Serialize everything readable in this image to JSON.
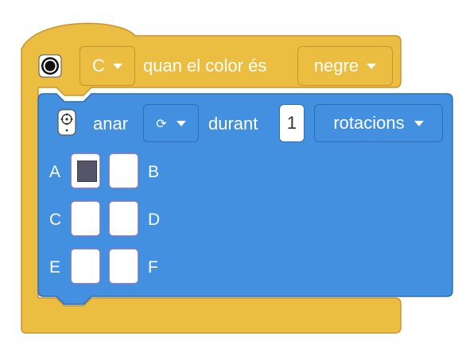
{
  "hat_block": {
    "port_value": "C",
    "condition_text": "quan el color és",
    "color_value": "negre",
    "color_hex": "#ebbd40"
  },
  "motor_block": {
    "action_text": "anar",
    "direction_icon": "rotate-icon",
    "direction_glyph": "⟳",
    "during_text": "durant",
    "amount_value": "1",
    "unit_value": "rotacions",
    "color_hex": "#4390e0"
  },
  "ports": [
    {
      "label": "A",
      "selected": true
    },
    {
      "label": "B",
      "selected": false
    },
    {
      "label": "C",
      "selected": false
    },
    {
      "label": "D",
      "selected": false
    },
    {
      "label": "E",
      "selected": false
    },
    {
      "label": "F",
      "selected": false
    }
  ]
}
